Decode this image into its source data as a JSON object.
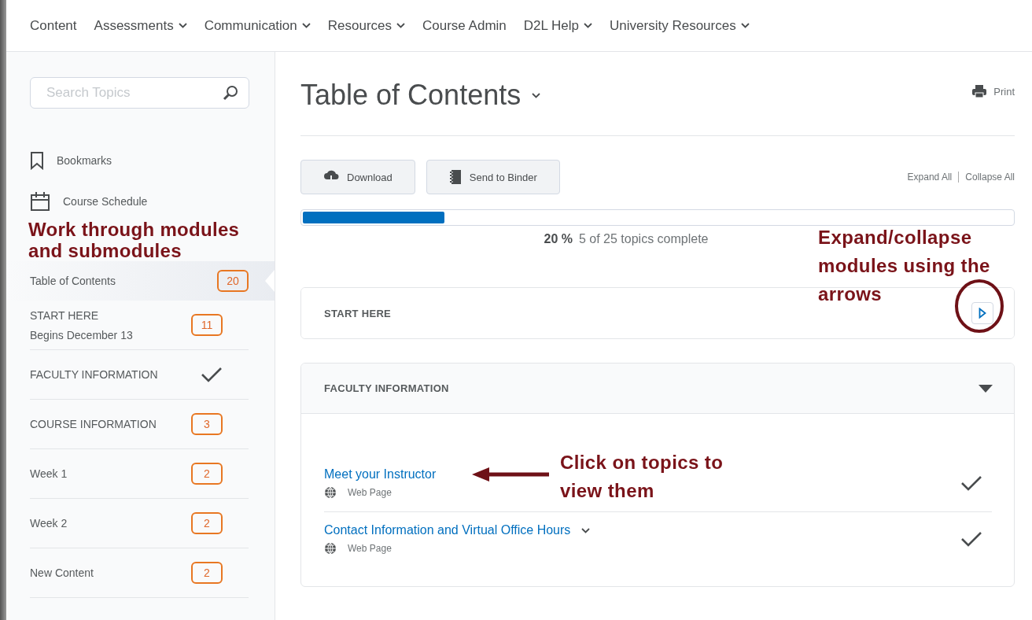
{
  "nav": [
    {
      "label": "Content",
      "has_menu": false
    },
    {
      "label": "Assessments",
      "has_menu": true
    },
    {
      "label": "Communication",
      "has_menu": true
    },
    {
      "label": "Resources",
      "has_menu": true
    },
    {
      "label": "Course Admin",
      "has_menu": false
    },
    {
      "label": "D2L Help",
      "has_menu": true
    },
    {
      "label": "University Resources",
      "has_menu": true
    }
  ],
  "sidebar": {
    "search": {
      "placeholder": "Search Topics"
    },
    "links": [
      {
        "label": "Bookmarks",
        "kind": "bookmark"
      },
      {
        "label": "Course Schedule",
        "kind": "calendar"
      }
    ],
    "items": [
      {
        "label": "Table of Contents",
        "badge": "20",
        "completed": false,
        "selected": true
      },
      {
        "label": "START HERE",
        "sublabel": "Begins December 13",
        "badge": "11",
        "completed": false,
        "selected": false
      },
      {
        "label": "FACULTY INFORMATION",
        "completed": true,
        "selected": false
      },
      {
        "label": "COURSE INFORMATION",
        "badge": "3",
        "completed": false,
        "selected": false
      },
      {
        "label": "Week 1",
        "badge": "2",
        "completed": false,
        "selected": false
      },
      {
        "label": "Week 2",
        "badge": "2",
        "completed": false,
        "selected": false
      },
      {
        "label": "New Content",
        "badge": "2",
        "completed": false,
        "selected": false
      }
    ]
  },
  "main": {
    "title": "Table of Contents",
    "print": "Print",
    "buttons": [
      {
        "label": "Download",
        "kind": "download"
      },
      {
        "label": "Send to Binder",
        "kind": "binder"
      }
    ],
    "expand_all": "Expand All",
    "collapse_all": "Collapse All",
    "progress": {
      "level": 0.2,
      "percent": "20 %",
      "summary": "5 of 25 topics complete"
    },
    "modules": [
      {
        "title": "START HERE",
        "expanded": false
      },
      {
        "title": "FACULTY INFORMATION",
        "expanded": true,
        "topics": [
          {
            "title": "Meet your Instructor",
            "type": "Web Page",
            "completed": true,
            "has_menu": false
          },
          {
            "title": "Contact Information and Virtual Office Hours",
            "type": "Web Page",
            "completed": true,
            "has_menu": true
          }
        ]
      }
    ]
  },
  "annotations": [
    {
      "kind": "sidebar",
      "lines": [
        "Work through modules",
        "and submodules"
      ]
    },
    {
      "kind": "expand",
      "lines": [
        "Expand/collapse",
        "modules using the",
        "arrows"
      ]
    },
    {
      "kind": "topics",
      "lines": [
        "Click on topics to",
        "view them"
      ]
    }
  ]
}
